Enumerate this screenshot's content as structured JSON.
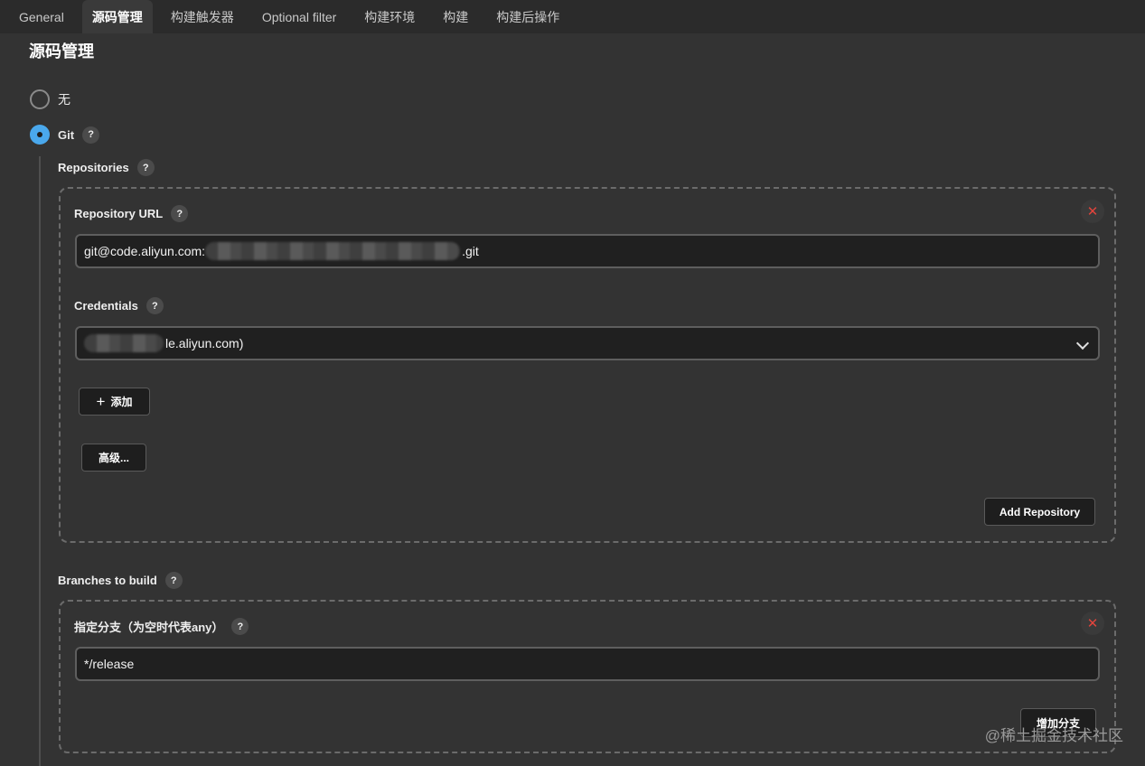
{
  "tabs": [
    "General",
    "源码管理",
    "构建触发器",
    "Optional filter",
    "构建环境",
    "构建",
    "构建后操作"
  ],
  "active_tab": "源码管理",
  "section_title": "源码管理",
  "scm_options": [
    {
      "label": "无",
      "checked": false
    },
    {
      "label": "Git",
      "checked": true
    }
  ],
  "help_glyph": "?",
  "repositories": {
    "label": "Repositories",
    "url_label": "Repository URL",
    "url_prefix": "git@code.aliyun.com:",
    "url_suffix": ".git",
    "credentials_label": "Credentials",
    "credentials_value_suffix": "le.aliyun.com)",
    "add_button": "添加",
    "advanced_button": "高级...",
    "add_repo_button": "Add Repository",
    "remove_glyph": "✕"
  },
  "branches": {
    "label": "Branches to build",
    "specifier_label": "指定分支（为空时代表any）",
    "specifier_value": "*/release",
    "add_branch_button": "增加分支",
    "remove_glyph": "✕"
  },
  "watermark": "@稀土掘金技术社区",
  "colors": {
    "accent_radio": "#4aa8ec",
    "remove_red": "#e0443c",
    "background": "#333333"
  }
}
